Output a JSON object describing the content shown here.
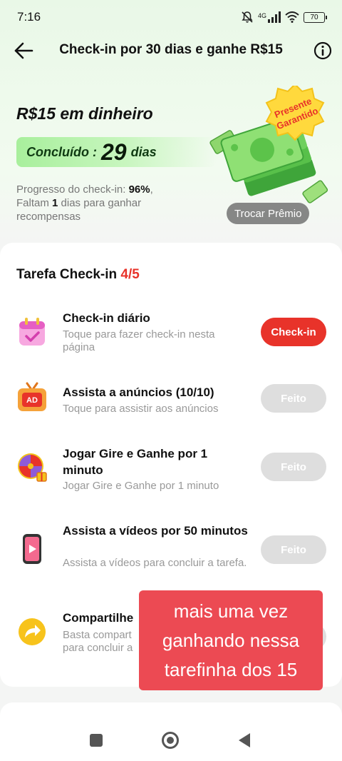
{
  "status": {
    "time": "7:16",
    "network": "4G",
    "battery": "70"
  },
  "header": {
    "title": "Check-in por 30 dias e ganhe R$15"
  },
  "hero": {
    "reward": "R$15 em dinheiro",
    "done_label": "Concluído :",
    "done_days": "29",
    "done_unit": "dias",
    "progress_prefix": "Progresso do check-in: ",
    "progress_value": "96%",
    "progress_sep": ",",
    "remaining_prefix": "Faltam ",
    "remaining_value": "1",
    "remaining_suffix": " dias para ganhar recompensas",
    "badge_line1": "Presente",
    "badge_line2": "Garantido",
    "swap_label": "Trocar Prêmio"
  },
  "tasks_section": {
    "title": "Tarefa Check-in ",
    "count": "4/5",
    "items": [
      {
        "name": "Check-in diário",
        "desc": "Toque para fazer check-in nesta página",
        "button": "Check-in",
        "icon": "calendar-icon"
      },
      {
        "name": "Assista a anúncios  (10/10)",
        "desc": "Toque para assistir aos anúncios",
        "button": "Feito",
        "icon": "ad-tv-icon"
      },
      {
        "name": "Jogar Gire e Ganhe por 1 minuto",
        "desc": "Jogar Gire e Ganhe por 1 minuto",
        "button": "Feito",
        "icon": "prize-wheel-icon"
      },
      {
        "name": "Assista a vídeos por 50 minutos",
        "desc": "Assista a vídeos para concluir a tarefa.",
        "button": "Feito",
        "icon": "video-phone-icon"
      },
      {
        "name": "Compartilhe",
        "desc": "Basta compart",
        "desc2": "para concluir a",
        "button": "",
        "icon": "share-arrow-icon"
      }
    ]
  },
  "overlay": {
    "line1": "mais uma vez",
    "line2": "ganhando nessa",
    "line3": "tarefinha dos 15"
  },
  "colors": {
    "accent_red": "#e8332a",
    "done_grey": "#dedede",
    "caption_bg": "#ec4a53",
    "green_pill": "#a8ef9c"
  }
}
